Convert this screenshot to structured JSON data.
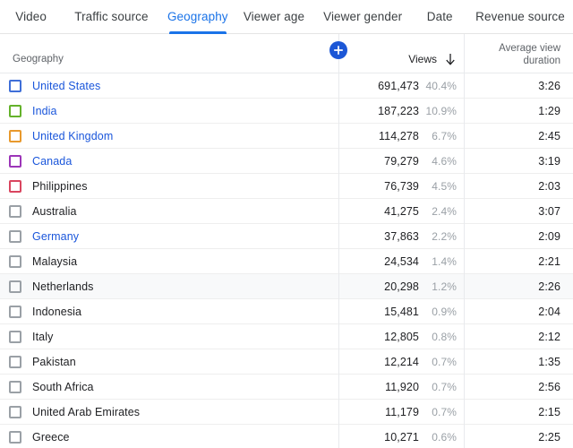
{
  "tabs": [
    {
      "label": "Video",
      "active": false,
      "key": "video"
    },
    {
      "label": "Traffic source",
      "active": false,
      "key": "traffic"
    },
    {
      "label": "Geography",
      "active": true,
      "key": "geography"
    },
    {
      "label": "Viewer age",
      "active": false,
      "key": "viewerage"
    },
    {
      "label": "Viewer gender",
      "active": false,
      "key": "viewergender"
    },
    {
      "label": "Date",
      "active": false,
      "key": "date"
    },
    {
      "label": "Revenue source",
      "active": false,
      "key": "revenue"
    }
  ],
  "table": {
    "headers": {
      "geography": "Geography",
      "views": "Views",
      "sort_indicator": "↓",
      "duration_line1": "Average view",
      "duration_line2": "duration"
    },
    "add_metric_button": "+",
    "rows": [
      {
        "geography": "United States",
        "views": "691,473",
        "percent": "40.4%",
        "duration": "3:26",
        "checkbox_color": "#3f6fd8",
        "link": true,
        "shaded": false
      },
      {
        "geography": "India",
        "views": "187,223",
        "percent": "10.9%",
        "duration": "1:29",
        "checkbox_color": "#64b22b",
        "link": true,
        "shaded": false
      },
      {
        "geography": "United Kingdom",
        "views": "114,278",
        "percent": "6.7%",
        "duration": "2:45",
        "checkbox_color": "#e8992d",
        "link": true,
        "shaded": false
      },
      {
        "geography": "Canada",
        "views": "79,279",
        "percent": "4.6%",
        "duration": "3:19",
        "checkbox_color": "#9c35b8",
        "link": true,
        "shaded": false
      },
      {
        "geography": "Philippines",
        "views": "76,739",
        "percent": "4.5%",
        "duration": "2:03",
        "checkbox_color": "#d9455f",
        "link": false,
        "shaded": false
      },
      {
        "geography": "Australia",
        "views": "41,275",
        "percent": "2.4%",
        "duration": "3:07",
        "checkbox_color": "#9aa0a6",
        "link": false,
        "shaded": false
      },
      {
        "geography": "Germany",
        "views": "37,863",
        "percent": "2.2%",
        "duration": "2:09",
        "checkbox_color": "#9aa0a6",
        "link": true,
        "shaded": false
      },
      {
        "geography": "Malaysia",
        "views": "24,534",
        "percent": "1.4%",
        "duration": "2:21",
        "checkbox_color": "#9aa0a6",
        "link": false,
        "shaded": false
      },
      {
        "geography": "Netherlands",
        "views": "20,298",
        "percent": "1.2%",
        "duration": "2:26",
        "checkbox_color": "#9aa0a6",
        "link": false,
        "shaded": true
      },
      {
        "geography": "Indonesia",
        "views": "15,481",
        "percent": "0.9%",
        "duration": "2:04",
        "checkbox_color": "#9aa0a6",
        "link": false,
        "shaded": false
      },
      {
        "geography": "Italy",
        "views": "12,805",
        "percent": "0.8%",
        "duration": "2:12",
        "checkbox_color": "#9aa0a6",
        "link": false,
        "shaded": false
      },
      {
        "geography": "Pakistan",
        "views": "12,214",
        "percent": "0.7%",
        "duration": "1:35",
        "checkbox_color": "#9aa0a6",
        "link": false,
        "shaded": false
      },
      {
        "geography": "South Africa",
        "views": "11,920",
        "percent": "0.7%",
        "duration": "2:56",
        "checkbox_color": "#9aa0a6",
        "link": false,
        "shaded": false
      },
      {
        "geography": "United Arab Emirates",
        "views": "11,179",
        "percent": "0.7%",
        "duration": "2:15",
        "checkbox_color": "#9aa0a6",
        "link": false,
        "shaded": false
      },
      {
        "geography": "Greece",
        "views": "10,271",
        "percent": "0.6%",
        "duration": "2:25",
        "checkbox_color": "#9aa0a6",
        "link": false,
        "shaded": false
      }
    ]
  },
  "colors": {
    "accent": "#1a73e8",
    "link": "#1a56db",
    "add_button": "#1c57d6",
    "text_primary": "#202124",
    "text_secondary": "#5f6368",
    "text_muted": "#9aa0a6",
    "row_shaded": "#f8f9fa",
    "divider": "#e8eaed"
  }
}
